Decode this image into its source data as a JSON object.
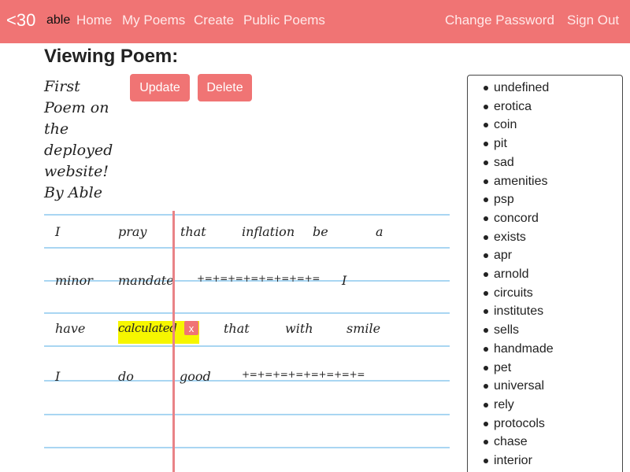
{
  "nav": {
    "brand": "<30",
    "user": "able",
    "links": [
      "Home",
      "My Poems",
      "Create",
      "Public Poems"
    ],
    "right_links": [
      "Change Password",
      "Sign Out"
    ]
  },
  "page_title": "Viewing Poem:",
  "poem": {
    "title": "First Poem on the deployed website! By Able",
    "lines": [
      [
        "I",
        "pray",
        "that",
        "inflation",
        "be",
        "a"
      ],
      [
        "minor",
        "mandate",
        "+=+=+=+=+=+=+=+=",
        "I"
      ],
      [
        "have",
        "calculated",
        "that",
        "with",
        "smile"
      ],
      [
        "I",
        "do",
        "good",
        "+=+=+=+=+=+=+=+="
      ]
    ],
    "selected_word": "calculated"
  },
  "actions": {
    "update": "Update",
    "delete": "Delete",
    "remove_word": "x"
  },
  "suggestions": [
    "undefined",
    "erotica",
    "coin",
    "pit",
    "sad",
    "amenities",
    "psp",
    "concord",
    "exists",
    "apr",
    "arnold",
    "circuits",
    "institutes",
    "sells",
    "handmade",
    "pet",
    "universal",
    "rely",
    "protocols",
    "chase",
    "interior"
  ],
  "colors": {
    "navbar": "#f07474",
    "button": "#f07474",
    "highlight": "#f6f600",
    "rule_line": "#a9d6f2",
    "margin_line": "#e98387"
  }
}
